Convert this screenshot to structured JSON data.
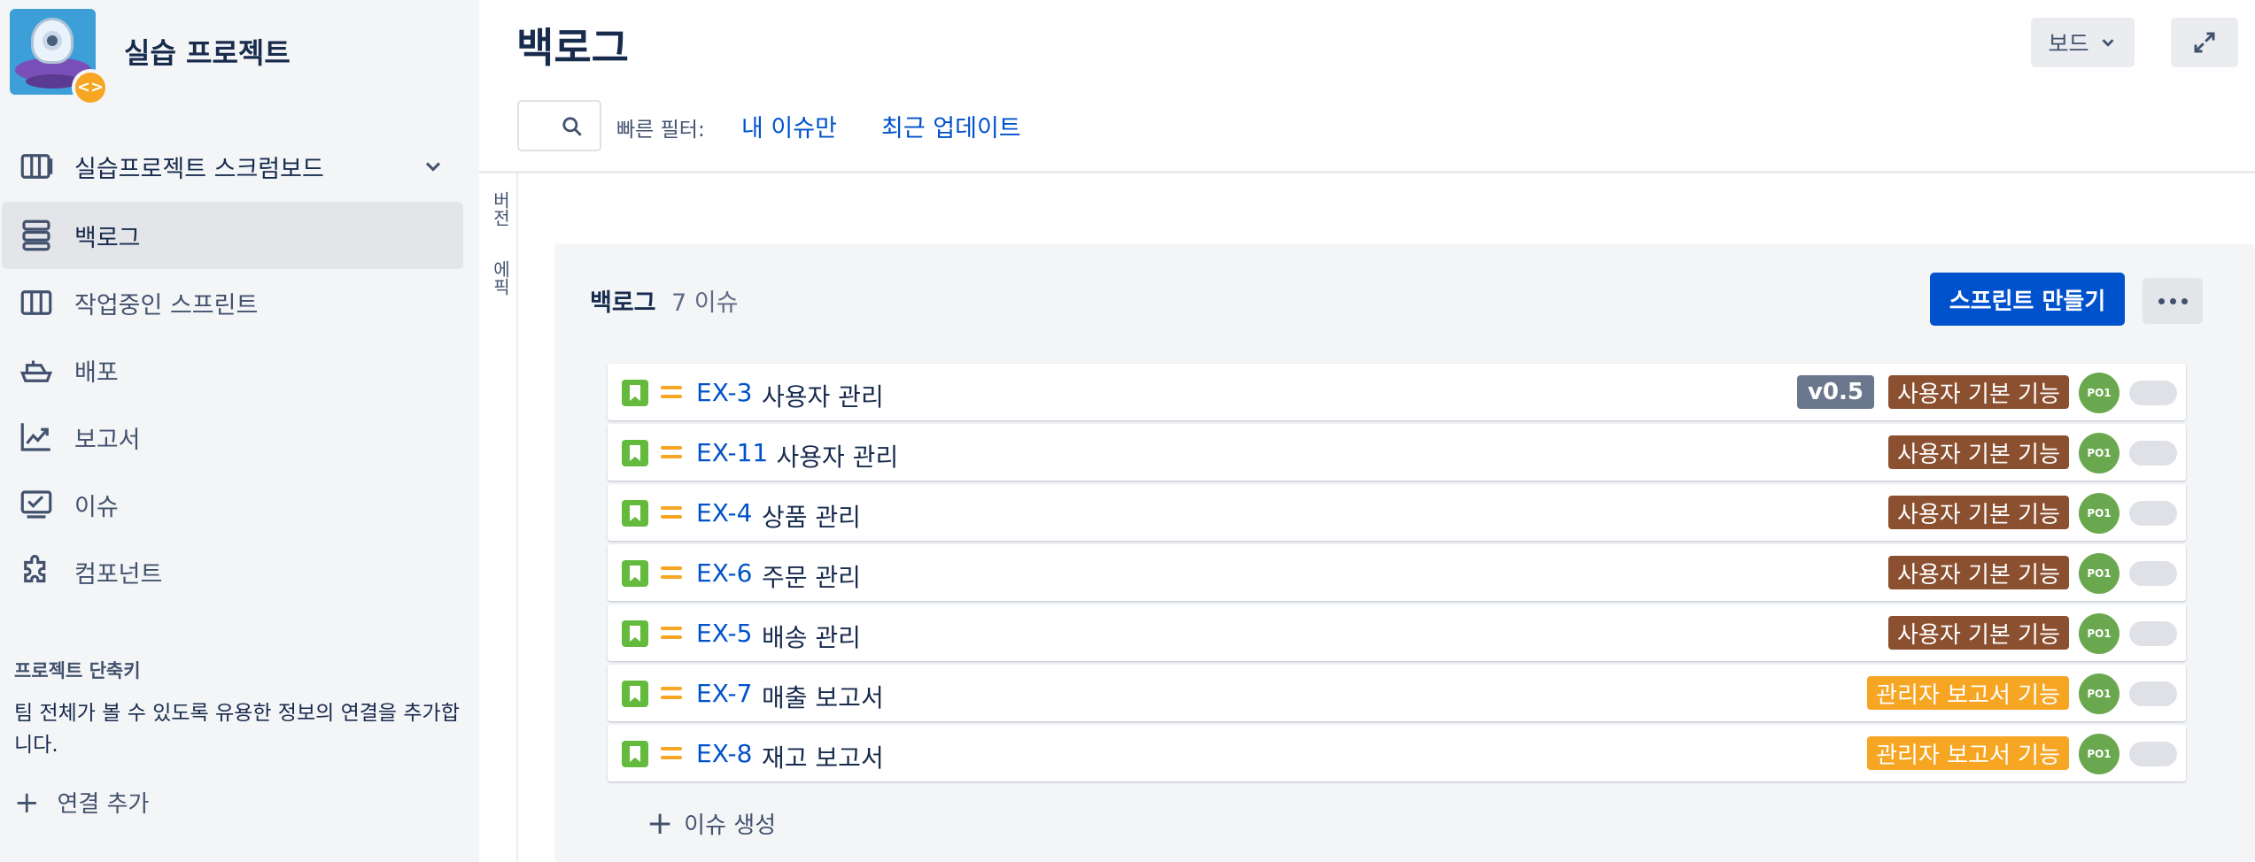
{
  "sidebar": {
    "project_name": "실습 프로젝트",
    "project_badge": "<>",
    "board_item": "실습프로젝트 스크럼보드",
    "items": [
      {
        "label": "백로그",
        "icon": "backlog-icon",
        "active": true
      },
      {
        "label": "작업중인 스프린트",
        "icon": "sprint-board-icon",
        "active": false
      },
      {
        "label": "배포",
        "icon": "ship-icon",
        "active": false
      },
      {
        "label": "보고서",
        "icon": "chart-line-icon",
        "active": false
      },
      {
        "label": "이슈",
        "icon": "issues-icon",
        "active": false
      },
      {
        "label": "컴포넌트",
        "icon": "puzzle-icon",
        "active": false
      }
    ],
    "shortcut_title": "프로젝트 단축키",
    "shortcut_desc": "팀 전체가 볼 수 있도록 유용한 정보의 연결을 추가합니다.",
    "add_link": "연결 추가"
  },
  "header": {
    "title": "백로그",
    "board_button": "보드",
    "search_placeholder": "",
    "quick_filter_label": "빠른 필터:",
    "quick_filters": [
      "내 이슈만",
      "최근 업데이트"
    ]
  },
  "rail": {
    "version": "버전",
    "epic": "에픽"
  },
  "backlog": {
    "title": "백로그",
    "count": "7 이슈",
    "create_sprint": "스프린트 만들기",
    "create_issue": "이슈 생성",
    "issues": [
      {
        "key": "EX-3",
        "summary": "사용자 관리",
        "version": "v0.5",
        "epic": "사용자 기본 기능",
        "epic_color": "#8b5030",
        "assignee": "PO1"
      },
      {
        "key": "EX-11",
        "summary": "사용자 관리",
        "version": "",
        "epic": "사용자 기본 기능",
        "epic_color": "#8b5030",
        "assignee": "PO1"
      },
      {
        "key": "EX-4",
        "summary": "상품 관리",
        "version": "",
        "epic": "사용자 기본 기능",
        "epic_color": "#8b5030",
        "assignee": "PO1"
      },
      {
        "key": "EX-6",
        "summary": "주문 관리",
        "version": "",
        "epic": "사용자 기본 기능",
        "epic_color": "#8b5030",
        "assignee": "PO1"
      },
      {
        "key": "EX-5",
        "summary": "배송 관리",
        "version": "",
        "epic": "사용자 기본 기능",
        "epic_color": "#8b5030",
        "assignee": "PO1"
      },
      {
        "key": "EX-7",
        "summary": "매출 보고서",
        "version": "",
        "epic": "관리자 보고서 기능",
        "epic_color": "#f6a623",
        "assignee": "PO1"
      },
      {
        "key": "EX-8",
        "summary": "재고 보고서",
        "version": "",
        "epic": "관리자 보고서 기능",
        "epic_color": "#f6a623",
        "assignee": "PO1"
      }
    ]
  },
  "colors": {
    "accent": "#0052cc",
    "story": "#63ba3c",
    "priority_medium": "#f6a623"
  }
}
